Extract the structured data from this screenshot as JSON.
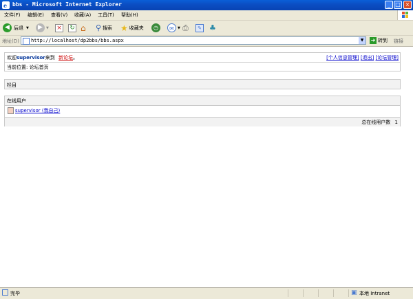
{
  "window": {
    "title": "bbs - Microsoft Internet Explorer",
    "controls": [
      "_",
      "□",
      "×"
    ]
  },
  "menu": [
    "文件(F)",
    "编辑(E)",
    "查看(V)",
    "收藏(A)",
    "工具(T)",
    "帮助(H)"
  ],
  "toolbar": {
    "back": "后退",
    "search": "搜索",
    "favorites": "收藏夹"
  },
  "address": {
    "label": "地址(D)",
    "url": "http://localhost/dp2bbs/bbs.aspx",
    "go": "转到",
    "links": "链接"
  },
  "page": {
    "welcome_prefix": "欢迎",
    "user": "supervisor",
    "welcome_mid": "来到",
    "forum_name": "新论坛",
    "welcome_suffix": "。",
    "links": [
      "[个人信息管理]",
      "[退出]",
      "[论坛管理]"
    ],
    "location": "当前位置: 论坛首页",
    "columns_header": "栏目",
    "online_header": "在线用户",
    "online_user": "supervisor (我自己)",
    "online_total_label": "总在线用户数",
    "online_total": "1"
  },
  "status": {
    "left": "完毕",
    "zone": "本地 Intranet"
  }
}
